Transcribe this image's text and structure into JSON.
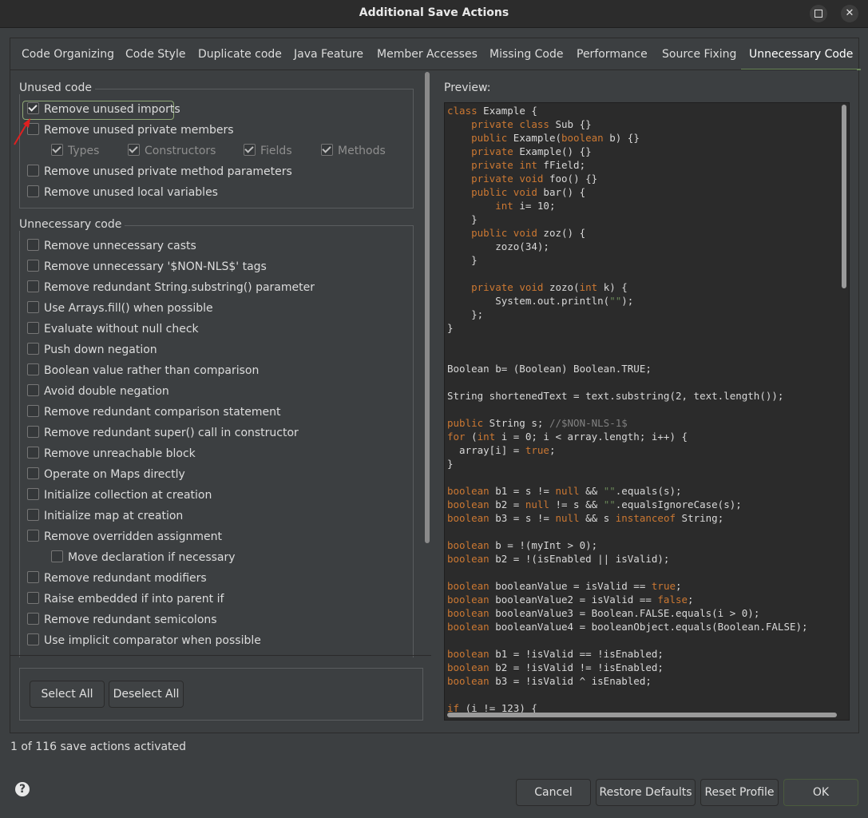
{
  "window": {
    "title": "Additional Save Actions"
  },
  "tabs": [
    {
      "label": "Code Organizing"
    },
    {
      "label": "Code Style"
    },
    {
      "label": "Duplicate code"
    },
    {
      "label": "Java Feature"
    },
    {
      "label": "Member Accesses"
    },
    {
      "label": "Missing Code"
    },
    {
      "label": "Performance"
    },
    {
      "label": "Source Fixing"
    },
    {
      "label": "Unnecessary Code",
      "active": true
    }
  ],
  "unused_code": {
    "title": "Unused code",
    "items": [
      {
        "label": "Remove unused imports",
        "checked": true
      },
      {
        "label": "Remove unused private members",
        "checked": false
      },
      {
        "label": "Remove unused private method parameters",
        "checked": false
      },
      {
        "label": "Remove unused local variables",
        "checked": false
      }
    ],
    "sub_items": [
      {
        "label": "Types",
        "checked": true
      },
      {
        "label": "Constructors",
        "checked": true
      },
      {
        "label": "Fields",
        "checked": true
      },
      {
        "label": "Methods",
        "checked": true
      }
    ]
  },
  "unnecessary_code": {
    "title": "Unnecessary code",
    "items": [
      {
        "label": "Remove unnecessary casts"
      },
      {
        "label": "Remove unnecessary '$NON-NLS$' tags"
      },
      {
        "label": "Remove redundant String.substring() parameter"
      },
      {
        "label": "Use Arrays.fill() when possible"
      },
      {
        "label": "Evaluate without null check"
      },
      {
        "label": "Push down negation"
      },
      {
        "label": "Boolean value rather than comparison"
      },
      {
        "label": "Avoid double negation"
      },
      {
        "label": "Remove redundant comparison statement"
      },
      {
        "label": "Remove redundant super() call in constructor"
      },
      {
        "label": "Remove unreachable block"
      },
      {
        "label": "Operate on Maps directly"
      },
      {
        "label": "Initialize collection at creation"
      },
      {
        "label": "Initialize map at creation"
      },
      {
        "label": "Remove overridden assignment"
      },
      {
        "label": "Move declaration if necessary"
      },
      {
        "label": "Remove redundant modifiers"
      },
      {
        "label": "Raise embedded if into parent if"
      },
      {
        "label": "Remove redundant semicolons"
      },
      {
        "label": "Use implicit comparator when possible"
      }
    ]
  },
  "buttons": {
    "select_all": "Select All",
    "deselect_all": "Deselect All",
    "cancel": "Cancel",
    "restore_defaults": "Restore Defaults",
    "reset_profile": "Reset Profile",
    "ok": "OK"
  },
  "preview": {
    "label": "Preview:",
    "code_lines": [
      "class Example {",
      "    private class Sub {}",
      "    public Example(boolean b) {}",
      "    private Example() {}",
      "    private int fField;",
      "    private void foo() {}",
      "    public void bar() {",
      "        int i= 10;",
      "    }",
      "    public void zoz() {",
      "        zozo(34);",
      "    }",
      "",
      "    private void zozo(int k) {",
      "        System.out.println(\"\");",
      "    };",
      "}",
      "",
      "",
      "Boolean b= (Boolean) Boolean.TRUE;",
      "",
      "String shortenedText = text.substring(2, text.length());",
      "",
      "public String s; //$NON-NLS-1$",
      "for (int i = 0; i < array.length; i++) {",
      "  array[i] = true;",
      "}",
      "",
      "boolean b1 = s != null && \"\".equals(s);",
      "boolean b2 = null != s && \"\".equalsIgnoreCase(s);",
      "boolean b3 = s != null && s instanceof String;",
      "",
      "boolean b = !(myInt > 0);",
      "boolean b2 = !(isEnabled || isValid);",
      "",
      "boolean booleanValue = isValid == true;",
      "boolean booleanValue2 = isValid == false;",
      "boolean booleanValue3 = Boolean.FALSE.equals(i > 0);",
      "boolean booleanValue4 = booleanObject.equals(Boolean.FALSE);",
      "",
      "boolean b1 = !isValid == !isEnabled;",
      "boolean b2 = !isValid != !isEnabled;",
      "boolean b3 = !isValid ^ isEnabled;",
      "",
      "if (i != 123) {"
    ]
  },
  "status": {
    "text": "1 of 116 save actions activated"
  },
  "colors": {
    "keyword": "#cc7832",
    "string": "#6a8759",
    "comment": "#808080",
    "focus": "#8fa876",
    "arrow": "#e02020"
  }
}
